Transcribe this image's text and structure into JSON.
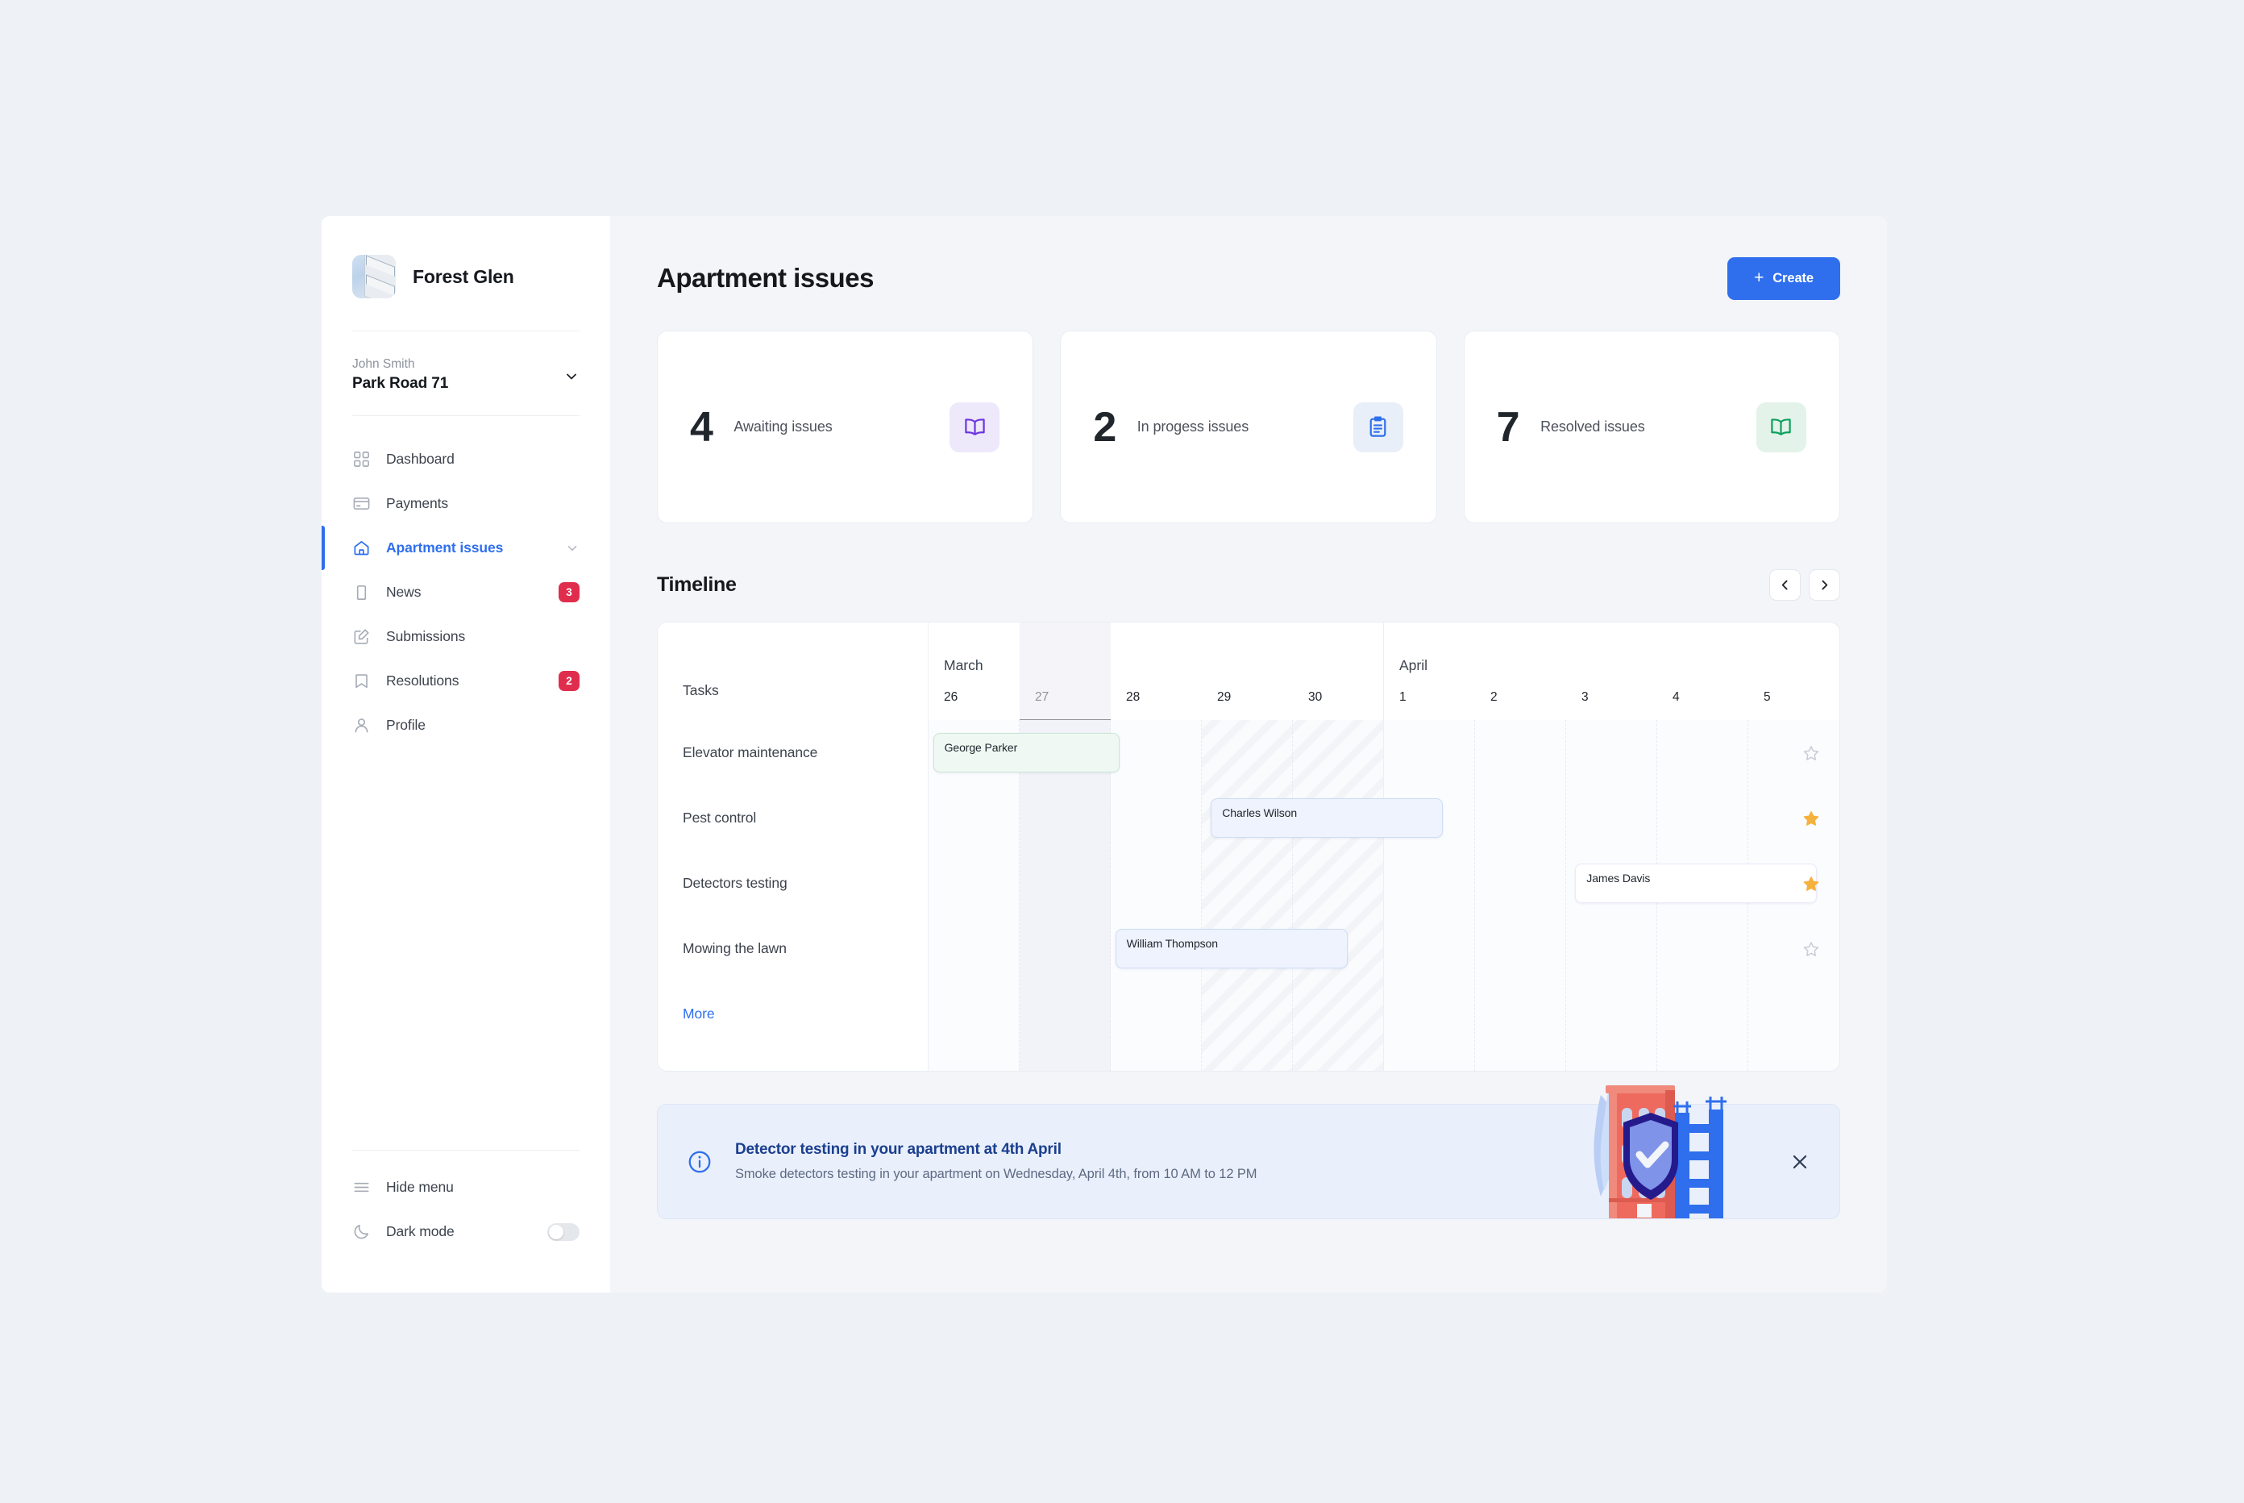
{
  "sidebar": {
    "brand": {
      "name": "Forest Glen",
      "avatar_icon": "building-photo"
    },
    "account": {
      "user_name": "John Smith",
      "address": "Park Road 71",
      "chevron_icon": "chevron-down-icon"
    },
    "nav": [
      {
        "label": "Dashboard",
        "icon": "grid-icon",
        "badge": "",
        "active": false,
        "chevron": false
      },
      {
        "label": "Payments",
        "icon": "credit-card-icon",
        "badge": "",
        "active": false,
        "chevron": false
      },
      {
        "label": "Apartment issues",
        "icon": "home-icon",
        "badge": "",
        "active": true,
        "chevron": true
      },
      {
        "label": "News",
        "icon": "clipboard-icon",
        "badge": "3",
        "active": false,
        "chevron": false
      },
      {
        "label": "Submissions",
        "icon": "edit-square-icon",
        "badge": "",
        "active": false,
        "chevron": false
      },
      {
        "label": "Resolutions",
        "icon": "bookmark-icon",
        "badge": "2",
        "active": false,
        "chevron": false
      },
      {
        "label": "Profile",
        "icon": "user-icon",
        "badge": "",
        "active": false,
        "chevron": false
      }
    ],
    "bottom": [
      {
        "label": "Hide menu",
        "icon": "hamburger-icon",
        "toggle": false
      },
      {
        "label": "Dark mode",
        "icon": "moon-icon",
        "toggle": true,
        "toggle_on": false
      }
    ]
  },
  "header": {
    "title": "Apartment issues",
    "create_label": "Create",
    "create_plus": "+"
  },
  "stats": [
    {
      "value": "4",
      "label": "Awaiting issues",
      "icon": "book-icon",
      "icon_color": "#6b35e0",
      "icon_bg": "#eee8fb"
    },
    {
      "value": "2",
      "label": "In progess issues",
      "icon": "clipboard-list-icon",
      "icon_color": "#2f6fed",
      "icon_bg": "#e9eff9"
    },
    {
      "value": "7",
      "label": "Resolved issues",
      "icon": "book-icon",
      "icon_color": "#0da05c",
      "icon_bg": "#e3f3ea"
    }
  ],
  "timeline": {
    "title": "Timeline",
    "prev_icon": "chevron-left-icon",
    "next_icon": "chevron-right-icon",
    "tasks_header": "Tasks",
    "more_label": "More",
    "months": [
      {
        "name": "March",
        "days": [
          "26",
          "27",
          "28",
          "29",
          "30"
        ]
      },
      {
        "name": "April",
        "days": [
          "1",
          "2",
          "3",
          "4",
          "5"
        ]
      }
    ],
    "today_day": "27",
    "weekend_days": [
      "29",
      "30"
    ],
    "rows": [
      {
        "task": "Elevator maintenance",
        "assignee": "George Parker",
        "start_day": 0.05,
        "span": 2.05,
        "color": "green",
        "starred": false
      },
      {
        "task": "Pest control",
        "assignee": "Charles Wilson",
        "start_day": 3.1,
        "span": 2.55,
        "color": "blue",
        "starred": true
      },
      {
        "task": "Detectors testing",
        "assignee": "James Davis",
        "start_day": 7.1,
        "span": 2.55,
        "color": "purple",
        "starred": true
      },
      {
        "task": "Mowing the lawn",
        "assignee": "William Thompson",
        "start_day": 2.05,
        "span": 2.55,
        "color": "blue",
        "starred": false
      }
    ]
  },
  "banner": {
    "info_icon": "info-circle-icon",
    "title": "Detector testing in your apartment at 4th April",
    "subtitle": "Smoke detectors testing in your apartment on Wednesday, April 4th, from 10 AM to 12 PM",
    "close_icon": "close-icon",
    "art_icon": "building-shield-illustration"
  },
  "colors": {
    "accent": "#2f6fed",
    "badge": "#e02d4e",
    "green": "#15a05a",
    "purple": "#6436e0",
    "star": "#f5b13d"
  }
}
